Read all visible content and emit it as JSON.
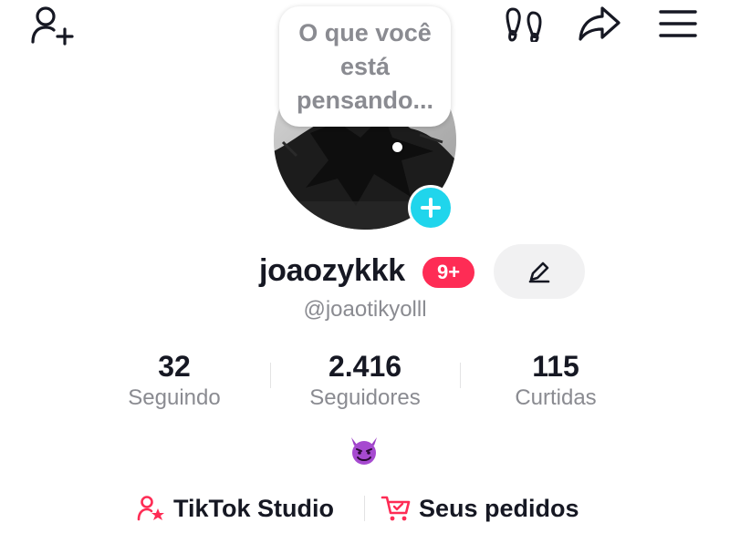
{
  "header": {
    "icons": [
      "add-friend-icon",
      "footprints-icon",
      "share-icon",
      "menu-icon"
    ]
  },
  "bubble": {
    "text": "O que você está pensando..."
  },
  "profile": {
    "display_name": "joaozykkk",
    "notification_badge": "9+",
    "handle": "@joaotikyolll",
    "emoji": "😈"
  },
  "stats": [
    {
      "value": "32",
      "label": "Seguindo"
    },
    {
      "value": "2.416",
      "label": "Seguidores"
    },
    {
      "value": "115",
      "label": "Curtidas"
    }
  ],
  "links": [
    {
      "label": "TikTok Studio"
    },
    {
      "label": "Seus pedidos"
    }
  ],
  "colors": {
    "accent_red": "#fe2c55",
    "accent_cyan": "#20d5ec",
    "text_primary": "#161823",
    "text_secondary": "#8a8b91"
  }
}
